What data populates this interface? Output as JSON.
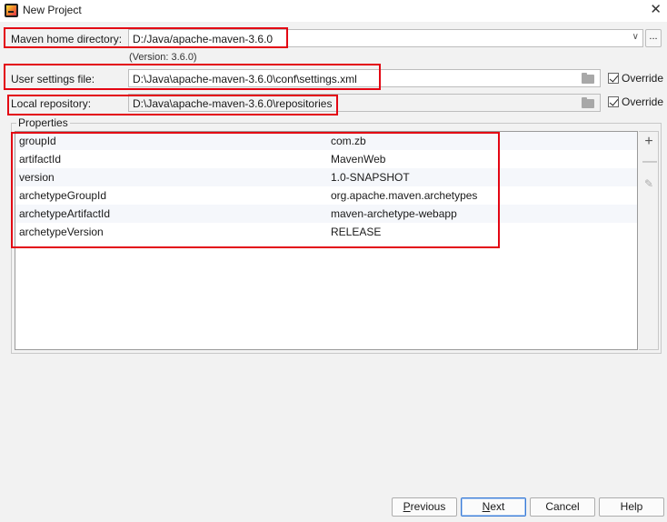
{
  "window": {
    "title": "New Project",
    "close_glyph": "✕"
  },
  "maven": {
    "home_label": "Maven home directory:",
    "home_value": "D:/Java/apache-maven-3.6.0",
    "version_note": "(Version: 3.6.0)",
    "browse_label": "...",
    "settings_label": "User settings file:",
    "settings_value": "D:\\Java\\apache-maven-3.6.0\\conf\\settings.xml",
    "settings_override": "Override",
    "repo_label": "Local repository:",
    "repo_value": "D:\\Java\\apache-maven-3.6.0\\repositories",
    "repo_override": "Override"
  },
  "properties": {
    "title": "Properties",
    "rows": [
      {
        "key": "groupId",
        "value": "com.zb"
      },
      {
        "key": "artifactId",
        "value": "MavenWeb"
      },
      {
        "key": "version",
        "value": "1.0-SNAPSHOT"
      },
      {
        "key": "archetypeGroupId",
        "value": "org.apache.maven.archetypes"
      },
      {
        "key": "archetypeArtifactId",
        "value": "maven-archetype-webapp"
      },
      {
        "key": "archetypeVersion",
        "value": "RELEASE"
      }
    ]
  },
  "buttons": {
    "previous_mn": "P",
    "previous_rest": "revious",
    "next_mn": "N",
    "next_rest": "ext",
    "cancel": "Cancel",
    "help": "Help"
  },
  "colors": {
    "highlight": "#e30613",
    "default_button_border": "#3a7bd5"
  },
  "icons": {
    "browse": "ellipsis-icon",
    "folder": "folder-icon",
    "add": "plus-icon",
    "remove": "minus-icon",
    "edit": "pencil-icon"
  }
}
